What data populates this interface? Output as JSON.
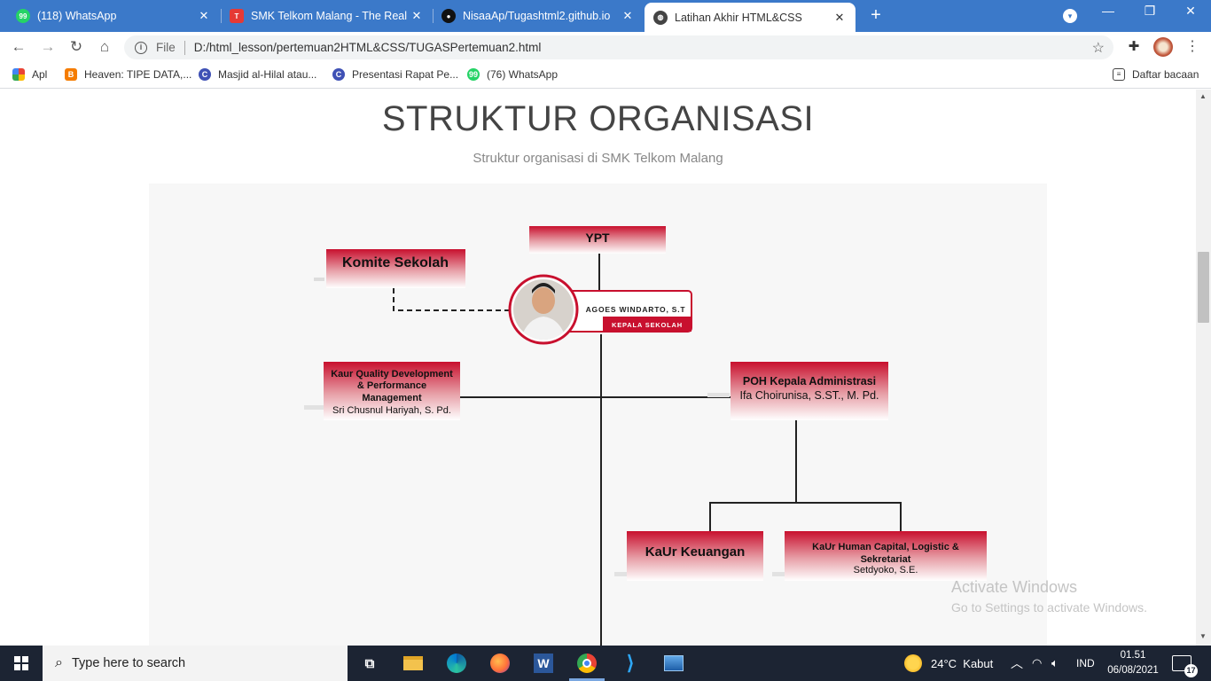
{
  "browser": {
    "tabs": [
      {
        "title": "(118) WhatsApp",
        "favicon": "whatsapp-icon",
        "active": false
      },
      {
        "title": "SMK Telkom Malang - The Real Ir",
        "favicon": "telkom-icon",
        "active": false
      },
      {
        "title": "NisaaAp/Tugashtml2.github.io",
        "favicon": "github-icon",
        "active": false
      },
      {
        "title": "Latihan Akhir HTML&CSS",
        "favicon": "globe-icon",
        "active": true
      }
    ],
    "address": {
      "scheme_label": "File",
      "url": "D:/html_lesson/pertemuan2HTML&CSS/TUGASPertemuan2.html"
    },
    "bookmarks": [
      {
        "label": "Apl",
        "icon": "apps-grid-icon"
      },
      {
        "label": "Heaven: TIPE DATA,...",
        "icon": "blogger-icon"
      },
      {
        "label": "Masjid al-Hilal atau...",
        "icon": "canva-icon"
      },
      {
        "label": "Presentasi Rapat Pe...",
        "icon": "canva-icon"
      },
      {
        "label": "(76) WhatsApp",
        "icon": "whatsapp-icon"
      }
    ],
    "reading_list_label": "Daftar bacaan"
  },
  "page": {
    "title": "STRUKTUR ORGANISASI",
    "subtitle": "Struktur organisasi di SMK Telkom Malang"
  },
  "org_chart": {
    "ypt": "YPT",
    "komite": "Komite Sekolah",
    "head_name": "AGOES WINDARTO, S.T",
    "head_role": "KEPALA SEKOLAH",
    "kaur_quality_line1": "Kaur Quality Development",
    "kaur_quality_line2": "& Performance",
    "kaur_quality_line3": "Management",
    "kaur_quality_person": "Sri Chusnul Hariyah, S. Pd.",
    "poh_title": "POH Kepala Administrasi",
    "poh_person": "Ifa Choirunisa, S.ST., M. Pd.",
    "keuangan": "KaUr Keuangan",
    "hc_line1": "KaUr Human Capital, Logistic &",
    "hc_line2": "Sekretariat",
    "hc_person": "Setdyoko, S.E."
  },
  "watermark": {
    "line1": "Activate Windows",
    "line2": "Go to Settings to activate Windows."
  },
  "taskbar": {
    "search_placeholder": "Type here to search",
    "weather": "24°C  Kabut",
    "language": "IND",
    "time": "01.51",
    "date": "06/08/2021",
    "notification_count": "17"
  },
  "colors": {
    "tabstrip": "#3b79c9",
    "card_red": "#c8102e",
    "taskbar": "#1c2433"
  }
}
